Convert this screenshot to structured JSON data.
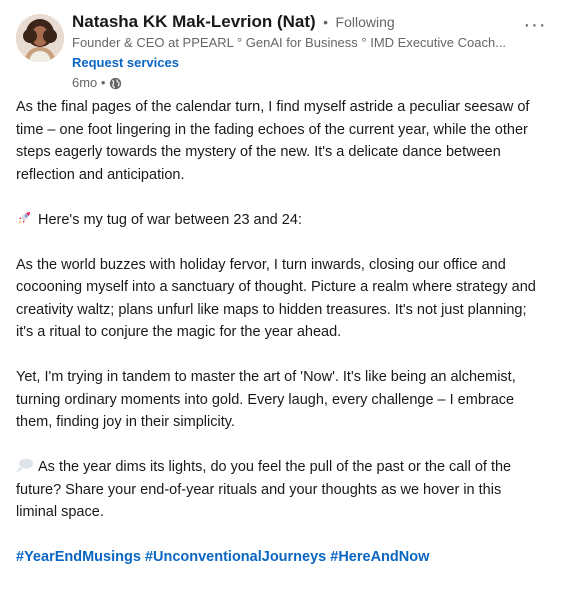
{
  "author": {
    "name": "Natasha KK Mak-Levrion (Nat)",
    "separator": "•",
    "follow_status": "Following",
    "headline": "Founder & CEO at PPEARL ° GenAI for Business ° IMD Executive Coach...",
    "cta": "Request services",
    "time": "6mo •",
    "visibility_icon": "globe-icon"
  },
  "menu": {
    "icon": "more-icon",
    "glyph": "···"
  },
  "post": {
    "p1": "As the final pages of the calendar turn, I find myself astride a peculiar seesaw of time – one foot lingering in the fading echoes of the current year, while the other steps eagerly towards the mystery of the new. It's a delicate dance between reflection and anticipation.",
    "p2_icon": "rocket-icon",
    "p2": "Here's my tug of war between 23 and 24:",
    "p3": "As the world buzzes with holiday fervor, I turn inwards, closing our office and cocooning myself into a sanctuary of thought. Picture a realm where strategy and creativity waltz; plans unfurl like maps to hidden treasures. It's not just planning; it's a ritual to conjure the magic for the year ahead.",
    "p4": "Yet, I'm trying in tandem to master the art of 'Now'. It's like being an alchemist, turning ordinary moments into gold. Every laugh, every challenge – I embrace them, finding joy in their simplicity.",
    "p5_icon": "thought-bubble-icon",
    "p5": "As the year dims its lights, do you feel the pull of the past or the call of the future? Share your end-of-year rituals and your thoughts as we hover in this liminal space.",
    "hashtags": [
      "#YearEndMusings",
      "#UnconventionalJourneys",
      "#HereAndNow"
    ]
  },
  "colors": {
    "link": "#0a66c2",
    "muted": "#666666",
    "text": "#191919"
  }
}
